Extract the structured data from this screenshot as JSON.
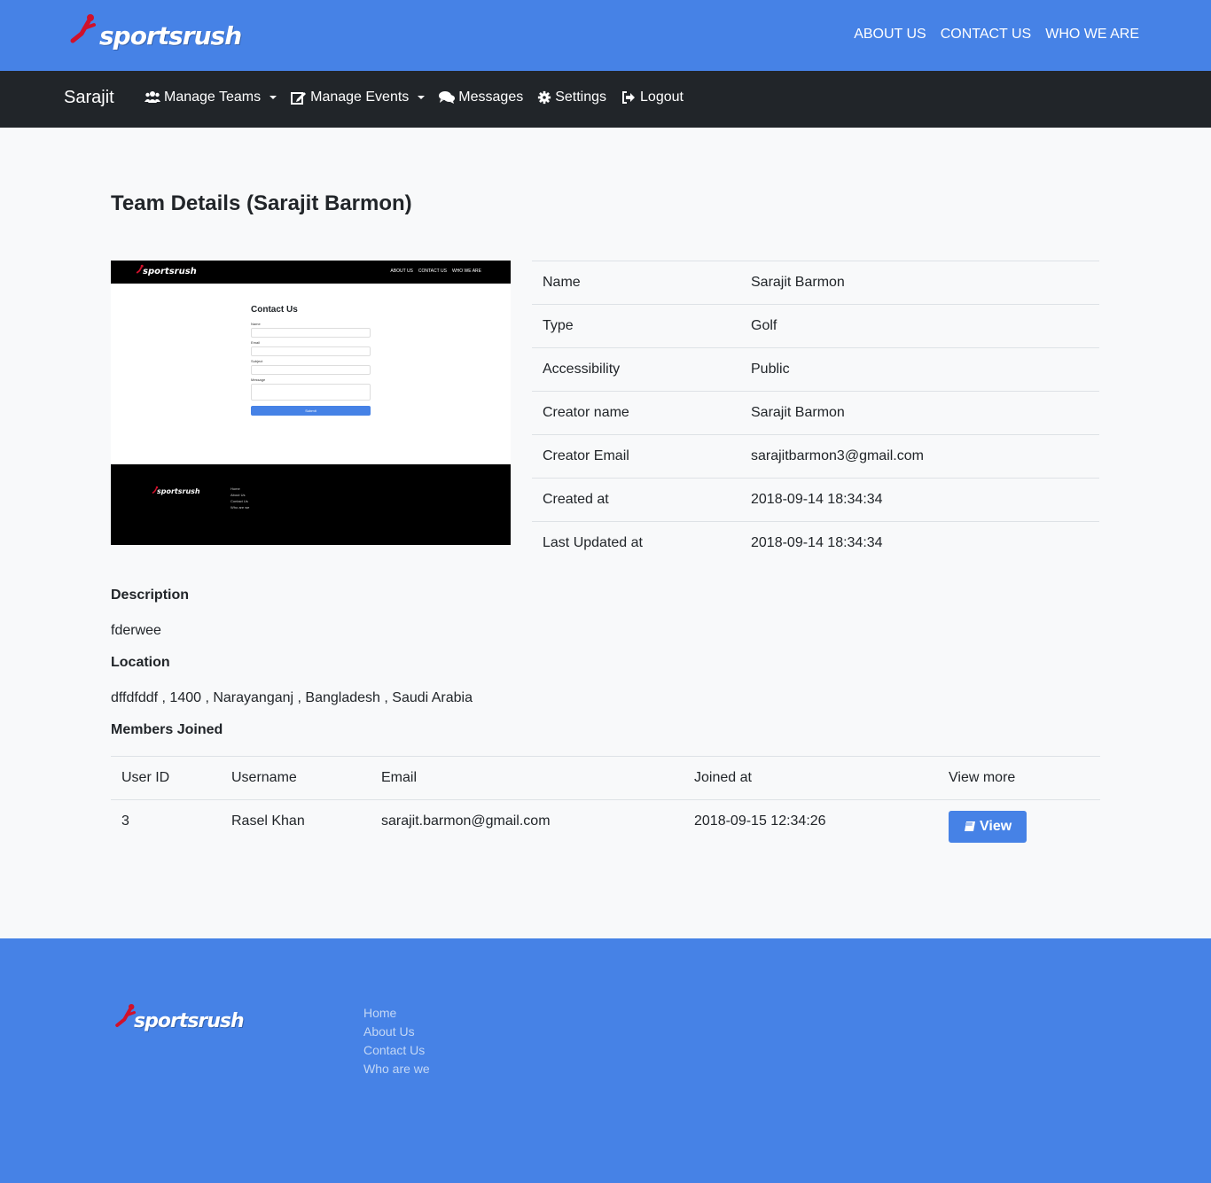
{
  "brand": {
    "logo_text": "sportsrush"
  },
  "top_links": [
    "ABOUT US",
    "CONTACT US",
    "WHO WE ARE"
  ],
  "nav": {
    "user": "Sarajit",
    "items": [
      {
        "label": "Manage Teams",
        "icon": "users-icon"
      },
      {
        "label": "Manage Events",
        "icon": "edit-icon"
      },
      {
        "label": "Messages",
        "icon": "comments-icon"
      },
      {
        "label": "Settings",
        "icon": "gear-icon"
      },
      {
        "label": "Logout",
        "icon": "logout-icon"
      }
    ]
  },
  "page_title": "Team Details (Sarajit Barmon)",
  "team_image": {
    "top_links": [
      "ABOUT US",
      "CONTACT US",
      "WHO WE ARE"
    ],
    "form_title": "Contact Us",
    "fields": [
      "Name",
      "Email",
      "Subject",
      "Message"
    ],
    "submit": "Submit",
    "footer_links": [
      "Home",
      "About Us",
      "Contact Us",
      "Who are we"
    ]
  },
  "details": [
    {
      "label": "Name",
      "value": "Sarajit Barmon"
    },
    {
      "label": "Type",
      "value": "Golf"
    },
    {
      "label": "Accessibility",
      "value": "Public"
    },
    {
      "label": "Creator name",
      "value": "Sarajit Barmon"
    },
    {
      "label": "Creator Email",
      "value": "sarajitbarmon3@gmail.com"
    },
    {
      "label": "Created at",
      "value": "2018-09-14 18:34:34"
    },
    {
      "label": "Last Updated at",
      "value": "2018-09-14 18:34:34"
    }
  ],
  "description": {
    "heading": "Description",
    "text": "fderwee"
  },
  "location": {
    "heading": "Location",
    "text": "dffdfddf , 1400 , Narayanganj , Bangladesh , Saudi Arabia"
  },
  "members": {
    "heading": "Members Joined",
    "columns": [
      "User ID",
      "Username",
      "Email",
      "Joined at",
      "View more"
    ],
    "rows": [
      {
        "user_id": "3",
        "username": "Rasel Khan",
        "email": "sarajit.barmon@gmail.com",
        "joined_at": "2018-09-15 12:34:26",
        "action": "View"
      }
    ]
  },
  "footer": {
    "links": [
      "Home",
      "About Us",
      "Contact Us",
      "Who are we"
    ]
  },
  "colors": {
    "primary": "#4682e6",
    "nav_dark": "#212529",
    "logo_red": "#d0112b"
  }
}
